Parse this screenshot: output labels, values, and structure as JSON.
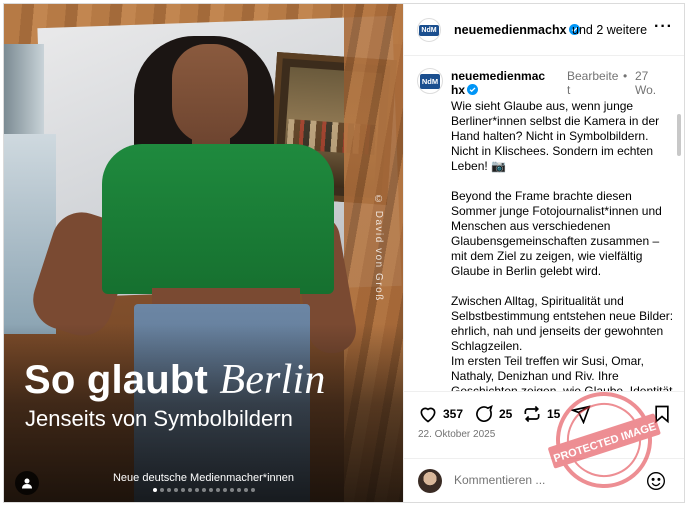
{
  "photo": {
    "title_main": "So glaubt",
    "title_italic": "Berlin",
    "subtitle": "Jenseits von Symbolbildern",
    "credit": "© David von Groß",
    "brand": "Neue deutsche Medienmacher*innen",
    "slides_total": 15,
    "slide_active": 1
  },
  "header": {
    "avatar_text": "NdM",
    "username": "neuemedienmachx",
    "verified": true,
    "collab": "und 2 weitere",
    "more_icon": "more-icon"
  },
  "caption": {
    "avatar_text": "NdM",
    "username": "neuemedienmachx",
    "edited": "Bearbeitet",
    "bullet": "•",
    "time": "27 Wo.",
    "paragraphs": [
      "Wie sieht Glaube aus, wenn junge Berliner*innen selbst die Kamera in der Hand halten? Nicht in Symbolbildern. Nicht in Klischees. Sondern im echten Leben! 📷",
      "Beyond the Frame brachte diesen Sommer junge Fotojournalist*innen und Menschen aus verschiedenen Glaubensgemeinschaften zusammen – mit dem Ziel zu zeigen, wie vielfältig Glaube in Berlin gelebt wird.",
      "Zwischen Alltag, Spiritualität und Selbstbestimmung entstehen neue Bilder: ehrlich, nah und jenseits der gewohnten Schlagzeilen.\nIm ersten Teil treffen wir Susi, Omar, Nathaly, Denizhan und Riv. Ihre Geschichten zeigen, wie Glaube, Identität"
    ]
  },
  "actions": {
    "likes": "357",
    "comments": "25",
    "reposts": "15",
    "date": "22. Oktober 2025"
  },
  "comment_box": {
    "placeholder": "Kommentieren ..."
  },
  "stamp": {
    "text": "PROTECTED IMAGE"
  },
  "colors": {
    "verified": "#0095f6",
    "muted": "#737373",
    "border": "#dbdbdb",
    "ndm_blue": "#1b4f8f"
  }
}
